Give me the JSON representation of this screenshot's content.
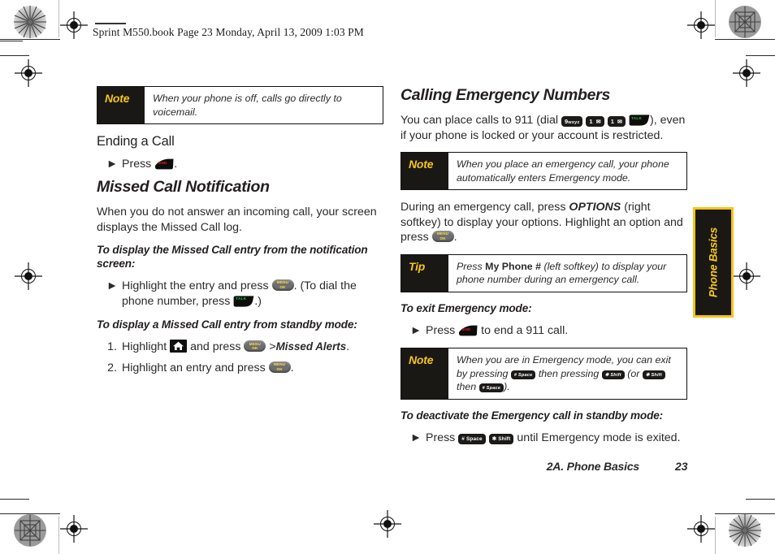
{
  "meta": {
    "slug": "Sprint M550.book  Page 23  Monday, April 13, 2009  1:03 PM"
  },
  "colors": {
    "note_label_bg": "#1a1815",
    "note_label_fg": "#f5c518",
    "tab_bg": "#1a1815",
    "tab_border": "#f5c518",
    "end_key_text": "#e02020",
    "talk_key_text": "#2fbf4f",
    "menu_key_bg": "#6e6e6e",
    "menu_key_text": "#ffe14d",
    "body_text": "#2a2a2a"
  },
  "left_column": {
    "note_1": {
      "label": "Note",
      "text": "When your phone is off, calls go directly to voicemail."
    },
    "heading_ending_call": "Ending a Call",
    "ending_call_step": {
      "marker": "►",
      "press": "Press",
      "key": "END",
      "period": "."
    },
    "heading_missed_call": "Missed Call Notification",
    "paragraph_1": "When you do not answer an incoming call, your screen displays the Missed Call log.",
    "lead_1": "To display the Missed Call entry from the notification screen:",
    "step_notification": {
      "marker": "►",
      "part1": "Highlight the entry and press",
      "key1": "MENU/OK",
      "part2": ". (To dial the phone number, press",
      "key2": "TALK",
      "part3": ".)"
    },
    "lead_2": "To display a Missed Call entry from standby mode:",
    "steps_standby": [
      {
        "number": "1.",
        "part1": "Highlight",
        "icon": "home-icon",
        "part2": "and press",
        "key": "MENU/OK",
        "part3": ">",
        "emphasis": "Missed Alerts",
        "part4": "."
      },
      {
        "number": "2.",
        "part1": "Highlight an entry and press",
        "key": "MENU/OK",
        "part2": "."
      }
    ]
  },
  "right_column": {
    "heading": "Calling Emergency Numbers",
    "paragraph_1": {
      "part1": "You can place calls to 911 (dial",
      "keys": [
        "9 wxyz",
        "1 ✉",
        "1 ✉",
        "TALK"
      ],
      "part2": "), even if your phone is locked or your account is restricted."
    },
    "note_1": {
      "label": "Note",
      "text": "When you place an emergency call, your phone automatically enters Emergency mode."
    },
    "paragraph_2": {
      "part1": "During an emergency call, press",
      "emphasis": "OPTIONS",
      "part2": "(right softkey) to display your options. Highlight an option and press",
      "key": "MENU/OK",
      "part3": "."
    },
    "tip_1": {
      "label": "Tip",
      "part1": "Press",
      "bold": "My Phone #",
      "part2": "(left softkey) to display your phone number during an emergency call."
    },
    "lead_1": "To exit Emergency mode:",
    "step_exit": {
      "marker": "►",
      "part1": "Press",
      "key": "END",
      "part2": "to end a 911 call."
    },
    "note_2": {
      "label": "Note",
      "part1": "When you are in Emergency mode, you can exit by pressing",
      "key1": "# Space",
      "part2": "then pressing",
      "key2": "✱ Shift",
      "part3": "(or",
      "key3": "✱ Shift",
      "part4": "then",
      "key4": "# Space",
      "part5": ")."
    },
    "lead_2": "To deactivate the Emergency call in standby mode:",
    "step_deactivate": {
      "marker": "►",
      "part1": "Press",
      "key1": "# Space",
      "key2": "✱ Shift",
      "part2": "until Emergency mode is exited."
    }
  },
  "thumb_tab": {
    "label": "Phone Basics"
  },
  "footer": {
    "title": "2A. Phone Basics",
    "page": "23"
  }
}
